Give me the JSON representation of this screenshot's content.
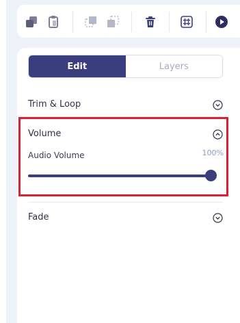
{
  "colors": {
    "accent": "#3b3e7e",
    "highlight_border": "#e02030",
    "percent_text": "#8aa0c8"
  },
  "toolbar": {
    "buttons": [
      {
        "icon": "copy-icon"
      },
      {
        "icon": "paste-icon"
      },
      {
        "icon": "bring-forward-icon"
      },
      {
        "icon": "send-backward-icon"
      },
      {
        "icon": "trash-icon"
      },
      {
        "icon": "grid-icon"
      },
      {
        "icon": "play-icon"
      }
    ]
  },
  "tabs": {
    "edit": "Edit",
    "layers": "Layers",
    "active": "Edit"
  },
  "sections": {
    "trim_loop": "Trim & Loop",
    "volume": {
      "title": "Volume",
      "sub_label": "Audio Volume",
      "percent_text": "100%",
      "value": 1.0
    },
    "fade": "Fade"
  }
}
